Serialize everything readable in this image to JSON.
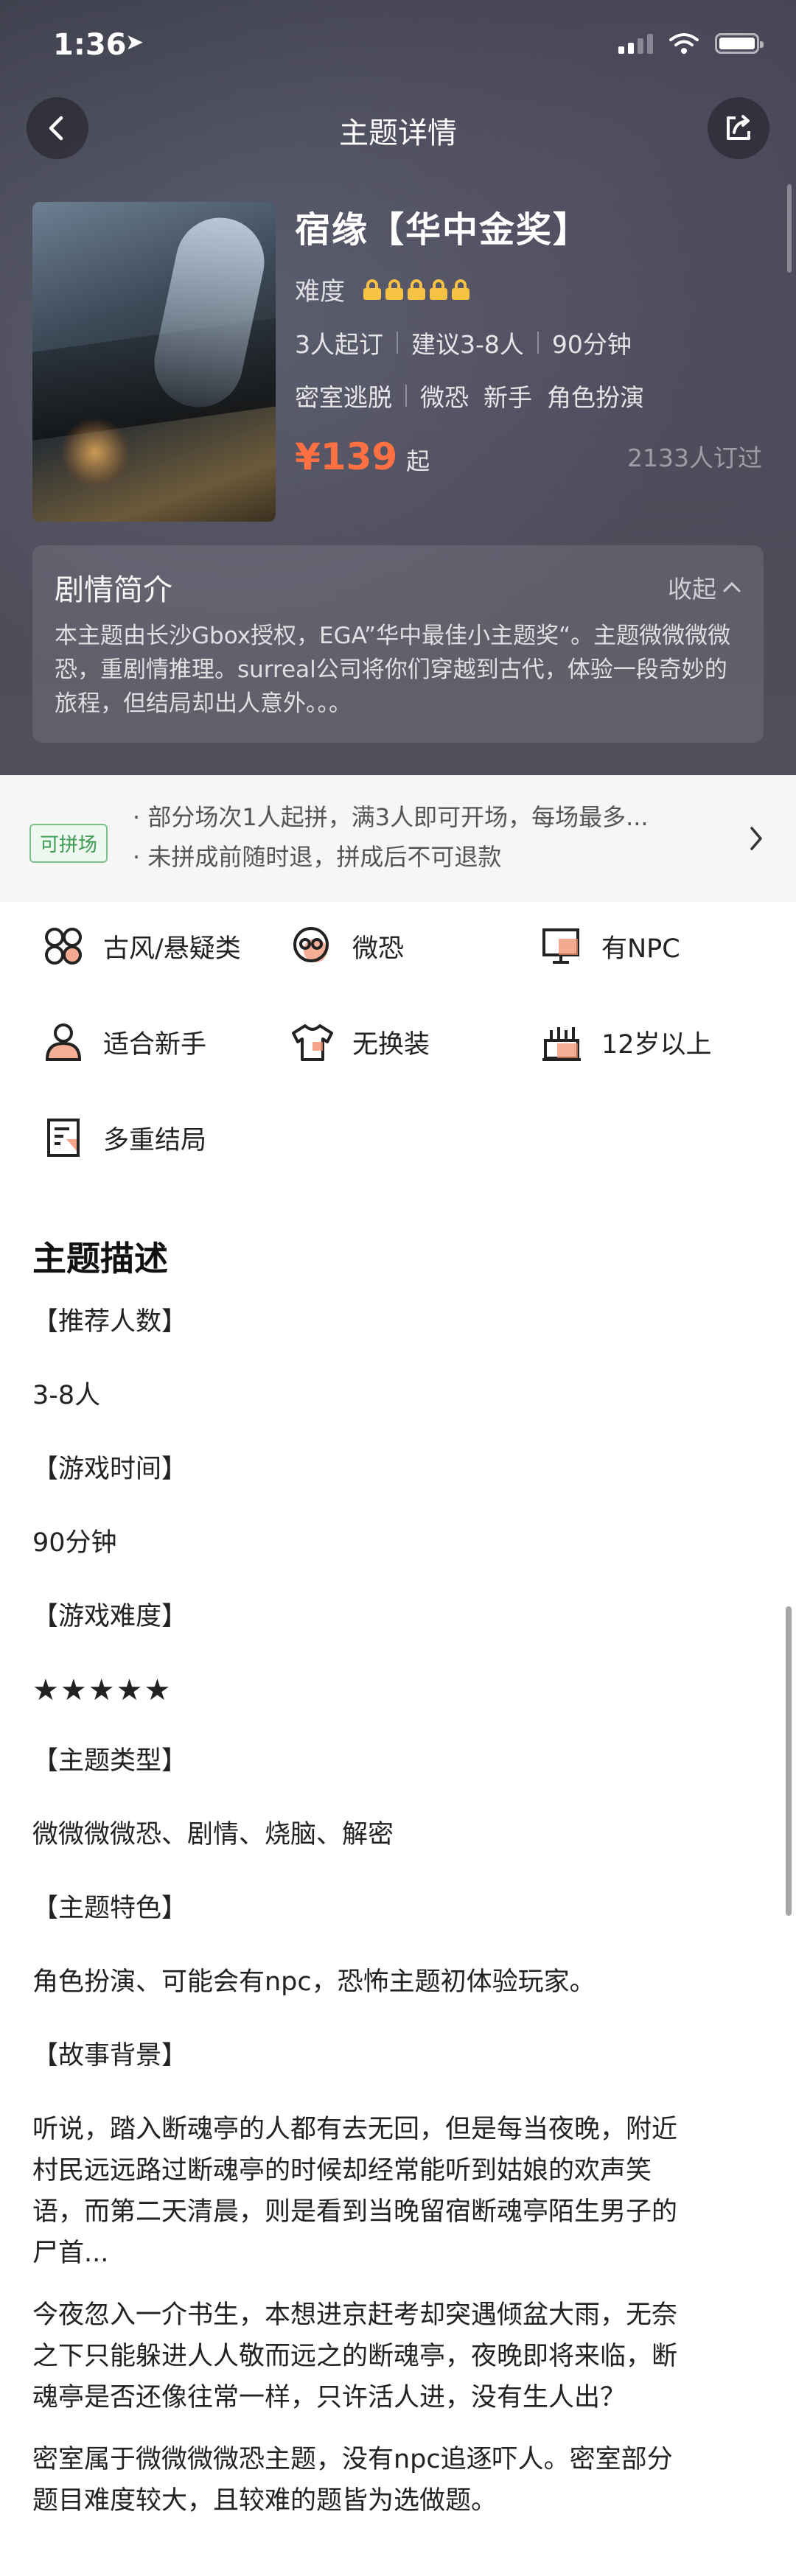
{
  "status_bar": {
    "time": "1:36",
    "location_arrow": "➤"
  },
  "nav": {
    "title": "主题详情",
    "back_icon": "chevron-left-icon",
    "share_icon": "share-icon"
  },
  "theme": {
    "title": "宿缘【华中金奖】",
    "difficulty_label": "难度",
    "difficulty_level": 5,
    "min_book": "3人起订",
    "suggested": "建议3-8人",
    "duration": "90分钟",
    "tags": [
      "密室逃脱",
      "微恐",
      "新手",
      "角色扮演"
    ],
    "price": "¥139",
    "price_suffix": "起",
    "booked": "2133人订过"
  },
  "synopsis": {
    "title": "剧情简介",
    "collapse_label": "收起",
    "text": "本主题由长沙Gbox授权，EGA”华中最佳小主题奖“。主题微微微微恐，重剧情推理。surreal公司将你们穿越到古代，体验一段奇妙的旅程，但结局却出人意外。。。"
  },
  "pin": {
    "badge": "可拼场",
    "line1": "· 部分场次1人起拼，满3人即可开场，每场最多...",
    "line2": "· 未拼成前随时退，拼成后不可退款"
  },
  "features": [
    {
      "icon": "category-icon",
      "label": "古风/悬疑类"
    },
    {
      "icon": "skull-icon",
      "label": "微恐"
    },
    {
      "icon": "monitor-icon",
      "label": "有NPC"
    },
    {
      "icon": "person-icon",
      "label": "适合新手"
    },
    {
      "icon": "shirt-icon",
      "label": "无换装"
    },
    {
      "icon": "age-icon",
      "label": "12岁以上"
    },
    {
      "icon": "document-icon",
      "label": "多重结局"
    }
  ],
  "description": {
    "title": "主题描述",
    "h_players": "【推荐人数】",
    "players": "3-8人",
    "h_time": "【游戏时间】",
    "time": "90分钟",
    "h_difficulty": "【游戏难度】",
    "stars": "★★★★★",
    "h_type": "【主题类型】",
    "type": "微微微微恐、剧情、烧脑、解密",
    "h_feature": "【主题特色】",
    "feature": "角色扮演、可能会有npc，恐怖主题初体验玩家。",
    "h_background": "【故事背景】",
    "bg1_l1": "听说，踏入断魂亭的人都有去无回，但是每当夜晚，附近",
    "bg1_l2": "村民远远路过断魂亭的时候却经常能听到姑娘的欢声笑",
    "bg1_l3": "语，而第二天清晨，则是看到当晚留宿断魂亭陌生男子的",
    "bg1_l4": "尸首...",
    "bg2_l1": "今夜忽入一介书生，本想进京赶考却突遇倾盆大雨，无奈",
    "bg2_l2": "之下只能躲进人人敬而远之的断魂亭，夜晚即将来临，断",
    "bg2_l3": "魂亭是否还像往常一样，只许活人进，没有生人出？",
    "bg3_l1": "密室属于微微微微恐主题，没有npc追逐吓人。密室部分",
    "bg3_l2": "题目难度较大，且较难的题皆为选做题。"
  },
  "colors": {
    "price": "#ff7043",
    "lock": "#f6c243",
    "pin_badge": "#3c9a52",
    "accent_icon": "#f28c6b"
  }
}
